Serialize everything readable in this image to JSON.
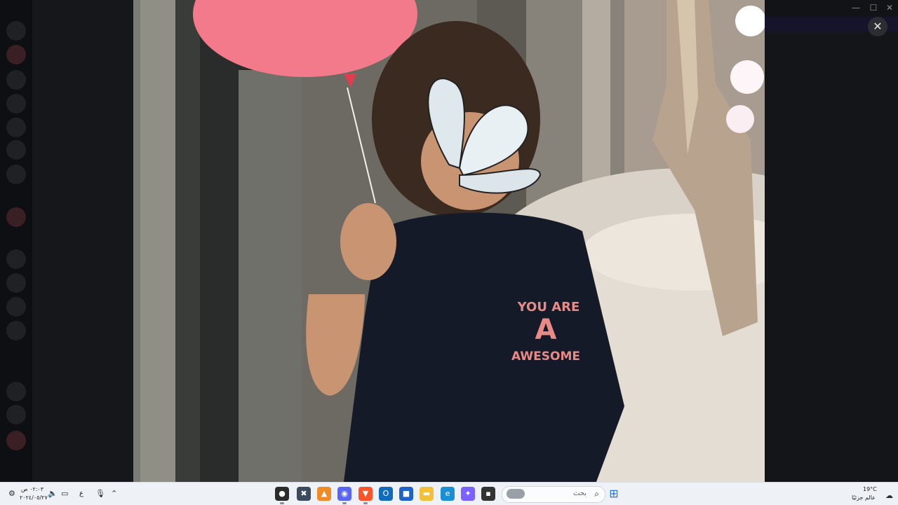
{
  "viewer": {
    "close_icon": "close-icon",
    "image_shirt_line1": "YOU ARE",
    "image_shirt_letter": "A",
    "image_shirt_line2": "AWESOME"
  },
  "window_controls": {
    "minimize": "—",
    "maximize": "☐",
    "close": "✕"
  },
  "taskbar": {
    "search_placeholder": "بحث",
    "weather_temp": "19°C",
    "weather_label": "عالم جزئيًا",
    "clock_time": "٠٢:٠٣ ص",
    "clock_date": "٢٠٢٤/٠٥/٢٧",
    "language": "ع",
    "apps": [
      {
        "name": "obs-studio",
        "glyph": "●",
        "color": "#2b2b2b"
      },
      {
        "name": "terminal",
        "glyph": "✖",
        "color": "#3b4a5c"
      },
      {
        "name": "vlc",
        "glyph": "▲",
        "color": "#f08a24"
      },
      {
        "name": "discord",
        "glyph": "◉",
        "color": "#5865f2"
      },
      {
        "name": "brave",
        "glyph": "▼",
        "color": "#fb542b"
      },
      {
        "name": "outlook",
        "glyph": "O",
        "color": "#0f6cbd"
      },
      {
        "name": "store",
        "glyph": "■",
        "color": "#1e63c9"
      },
      {
        "name": "file-explorer",
        "glyph": "▬",
        "color": "#f2c037"
      },
      {
        "name": "edge",
        "glyph": "e",
        "color": "#1a8fd6"
      },
      {
        "name": "copilot",
        "glyph": "✦",
        "color": "#7b61ff"
      },
      {
        "name": "task-view",
        "glyph": "▪",
        "color": "#333333"
      }
    ]
  }
}
